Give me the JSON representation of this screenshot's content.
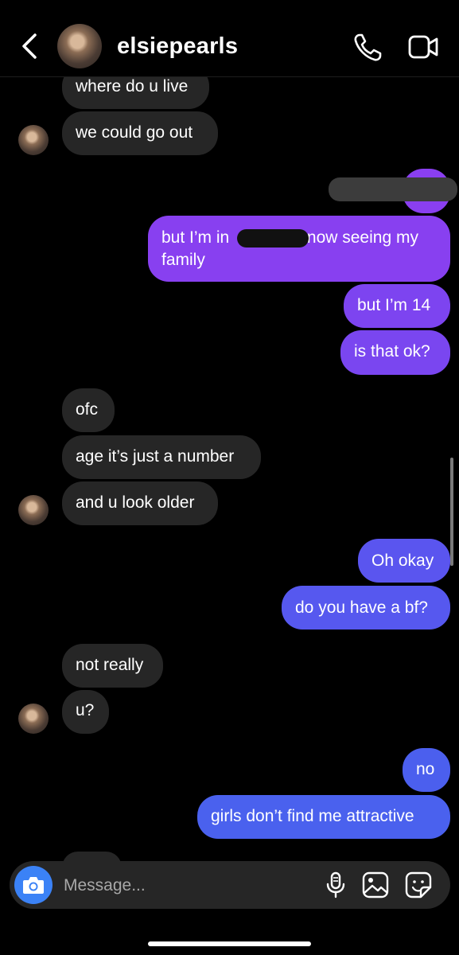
{
  "header": {
    "username": "elsiepearls"
  },
  "messages": [
    {
      "from": "them",
      "text": "where do u live"
    },
    {
      "from": "them",
      "text": "we could go out"
    },
    {
      "from": "me",
      "text": ""
    },
    {
      "from": "me",
      "text_before": "but I’m in",
      "text_after": "now seeing my",
      "text_line2": "family"
    },
    {
      "from": "me",
      "text": "but I’m 14"
    },
    {
      "from": "me",
      "text": "is that ok?"
    },
    {
      "from": "them",
      "text": "ofc"
    },
    {
      "from": "them",
      "text": "age it’s just a number"
    },
    {
      "from": "them",
      "text": "and u look older"
    },
    {
      "from": "me",
      "text": "Oh okay"
    },
    {
      "from": "me",
      "text": "do you have a bf?"
    },
    {
      "from": "them",
      "text": "not really"
    },
    {
      "from": "them",
      "text": "u?"
    },
    {
      "from": "me",
      "text": "no"
    },
    {
      "from": "me",
      "text": "girls don’t find me attractive"
    }
  ],
  "composer": {
    "placeholder": "Message..."
  },
  "colors": {
    "incoming": "#262626",
    "outgoing_top": "#8a3ff0",
    "outgoing_mid": "#6c4cf0",
    "outgoing_bottom": "#4a5fee",
    "camera": "#3b82f6"
  },
  "icons": [
    "back-chevron-icon",
    "phone-icon",
    "video-camera-icon",
    "camera-icon",
    "microphone-icon",
    "gallery-icon",
    "sticker-icon"
  ]
}
